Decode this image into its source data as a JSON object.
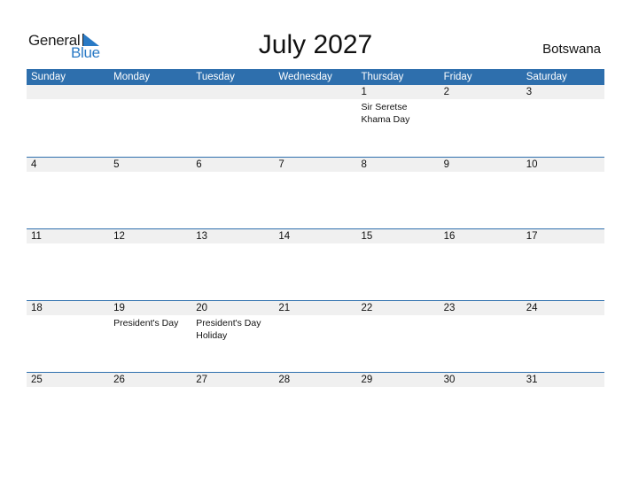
{
  "logo": {
    "general": "General",
    "blue": "Blue"
  },
  "title": "July 2027",
  "country": "Botswana",
  "colors": {
    "header_bg": "#2e6fad",
    "date_strip_bg": "#f0f0f0",
    "logo_blue": "#2a7ac5"
  },
  "weekdays": [
    "Sunday",
    "Monday",
    "Tuesday",
    "Wednesday",
    "Thursday",
    "Friday",
    "Saturday"
  ],
  "weeks": [
    {
      "days": [
        "",
        "",
        "",
        "",
        "1",
        "2",
        "3"
      ],
      "events": [
        "",
        "",
        "",
        "",
        "Sir Seretse Khama Day",
        "",
        ""
      ]
    },
    {
      "days": [
        "4",
        "5",
        "6",
        "7",
        "8",
        "9",
        "10"
      ],
      "events": [
        "",
        "",
        "",
        "",
        "",
        "",
        ""
      ]
    },
    {
      "days": [
        "11",
        "12",
        "13",
        "14",
        "15",
        "16",
        "17"
      ],
      "events": [
        "",
        "",
        "",
        "",
        "",
        "",
        ""
      ]
    },
    {
      "days": [
        "18",
        "19",
        "20",
        "21",
        "22",
        "23",
        "24"
      ],
      "events": [
        "",
        "President's Day",
        "President's Day Holiday",
        "",
        "",
        "",
        ""
      ]
    },
    {
      "days": [
        "25",
        "26",
        "27",
        "28",
        "29",
        "30",
        "31"
      ],
      "events": [
        "",
        "",
        "",
        "",
        "",
        "",
        ""
      ]
    }
  ]
}
